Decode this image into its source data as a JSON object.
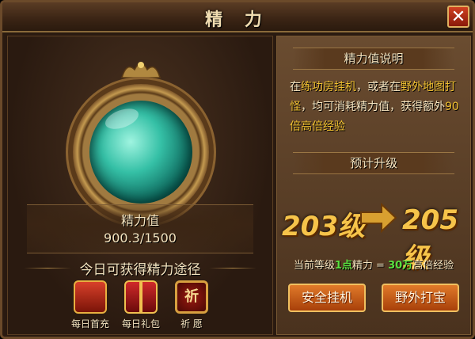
{
  "window": {
    "title": "精 力",
    "close_symbol": "✕"
  },
  "left": {
    "energy_label": "精力值",
    "energy_value": "900.3/1500",
    "energy_current": 900.3,
    "energy_max": 1500,
    "ways_title": "今日可获得精力途径",
    "ways": [
      {
        "label": "每日首充",
        "icon": "treasure-chest-icon"
      },
      {
        "label": "每日礼包",
        "icon": "gift-box-icon"
      },
      {
        "label": "祈 愿",
        "icon": "pray-icon",
        "glyph": "祈"
      }
    ]
  },
  "right": {
    "explain_title": "精力值说明",
    "desc_parts": {
      "p1": "在",
      "h1": "练功房挂机",
      "p2": "，或者在",
      "h2": "野外地图打怪",
      "p3": "，均可消耗精力值，获得额外",
      "h3": "90倍高倍经验"
    },
    "forecast_title": "预计升级",
    "level_from": "203级",
    "level_to": "205级",
    "current_parts": {
      "p1": "当前等级",
      "n1": "1点",
      "p2": "精力 = ",
      "n2": "30万",
      "p3": "高倍经验"
    },
    "buttons": {
      "safe_afk": "安全挂机",
      "field_treasure": "野外打宝"
    }
  },
  "colors": {
    "accent_gold": "#f6c44a",
    "highlight": "#f0c030",
    "green_num": "#5ae040",
    "button": "#c45a16"
  }
}
